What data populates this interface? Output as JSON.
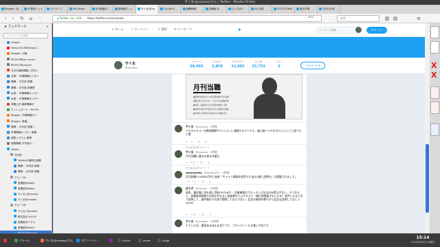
{
  "window": {
    "title": "サイ太(@vaaaaa)さん | Twitter - Mozilla Firefox"
  },
  "tabs": [
    {
      "label": "Blogger: 月..."
    },
    {
      "label": "M 受信トレイ"
    },
    {
      "label": "Gドライブ"
    },
    {
      "label": "Pop News"
    },
    {
      "label": "JRS数値(E)"
    },
    {
      "label": "新幹線ネット"
    },
    {
      "label": "サイ太(@va"
    },
    {
      "label": "(1)GoPro"
    },
    {
      "label": "報酬明細"
    },
    {
      "label": "投稿者 AI"
    },
    {
      "label": "(1) ZOZO"
    },
    {
      "label": "(6) 社説"
    },
    {
      "label": "ZOZOTOWN"
    },
    {
      "label": "楽天市場"
    },
    {
      "label": "今日の天気"
    }
  ],
  "navbar": {
    "url_prefix": "Twitter, Inc. (US)",
    "url": "https://twitter.com/vaaaaa",
    "zoom": "90%",
    "search_placeholder": "検索"
  },
  "sidebar": {
    "title": "ブックマーク",
    "search_placeholder": "ブックマークを検索",
    "items": [
      {
        "label": "Google",
        "color": "#4285f4",
        "indent": 2
      },
      {
        "label": "Yahoo!2018年Yahoo!ニ",
        "color": "#ff0033",
        "indent": 2
      },
      {
        "label": "Blogger: 日報",
        "color": "#f57c00",
        "indent": 2
      },
      {
        "label": "BE2018年kw movie",
        "color": "#777777",
        "indent": 2
      },
      {
        "label": "BE2017年project",
        "color": "#777777",
        "indent": 2
      },
      {
        "label": "今日の最新情報 | 月刊リ",
        "color": "#e53935",
        "indent": 2
      },
      {
        "label": "出発・ 市場情報センター",
        "color": "#1e88e5",
        "indent": 2
      },
      {
        "label": "業績・ 月刊誌 実績",
        "color": "#1e88e5",
        "indent": 2
      },
      {
        "label": "業績・ 月刊誌 実績表",
        "color": "#1e88e5",
        "indent": 2
      },
      {
        "label": "出発・ 市場情報センター",
        "color": "#1e88e5",
        "indent": 2
      },
      {
        "label": "出発・ 市場情報センター",
        "color": "#1e88e5",
        "indent": 2
      },
      {
        "label": "求職上位 最新情報が",
        "color": "#e53935",
        "indent": 2
      },
      {
        "label": "ディシュボード : My Pro",
        "color": "#43a047",
        "indent": 2
      },
      {
        "label": "Blogger: 市場情報セン",
        "color": "#f57c00",
        "indent": 2
      },
      {
        "label": "Blogger: 数値_",
        "color": "#f57c00",
        "indent": 2
      },
      {
        "label": "業績・ 月刊誌 実績 1",
        "color": "#1e88e5",
        "indent": 2
      },
      {
        "label": "市場情報センター 実績",
        "color": "#1e88e5",
        "indent": 2
      },
      {
        "label": "複数システム 実績",
        "color": "#1e88e5",
        "indent": 2
      },
      {
        "label": "複数情報 月刊誌の...",
        "color": "#777777",
        "indent": 2
      },
      {
        "label": "Twitter",
        "color": "#1da1f2",
        "indent": 2
      },
      {
        "label": "月刊誌",
        "color": "#999999",
        "indent": 3
      },
      {
        "label": "Twitterの最新な実績",
        "color": "#1da1f2",
        "indent": 4
      },
      {
        "label": "業績・ 月刊誌 実績",
        "color": "#1e88e5",
        "indent": 4
      },
      {
        "label": "業績・ 月刊誌 実績",
        "color": "#1e88e5",
        "indent": 4
      },
      {
        "label": "グループA",
        "color": "#999999",
        "indent": 3
      },
      {
        "label": "営業部@Adelh",
        "color": "#1da1f2",
        "indent": 4
      },
      {
        "label": "営業部@Adela",
        "color": "#1da1f2",
        "indent": 4
      },
      {
        "label": "サイ太 (@vaaaa)",
        "color": "#1da1f2",
        "indent": 4
      },
      {
        "label": "サイ太@vaaaaa",
        "color": "#1da1f2",
        "indent": 4
      },
      {
        "label": "グループB",
        "color": "#999999",
        "indent": 3
      },
      {
        "label": "サイ太 (@Adelh)",
        "color": "#1da1f2",
        "indent": 4
      },
      {
        "label": "株式会社 Yuji Gr",
        "color": "#1da1f2",
        "indent": 4
      },
      {
        "label": "営業部@アドカ",
        "color": "#1da1f2",
        "indent": 4
      },
      {
        "label": "営業部@Adelh",
        "color": "#1da1f2",
        "indent": 4
      },
      {
        "label": "株式会社@Adelh",
        "color": "#1da1f2",
        "indent": 4,
        "selected": true
      },
      {
        "label": "池田株式会社の",
        "color": "#1da1f2",
        "indent": 4
      },
      {
        "label": "株式会社 HALI",
        "color": "#1da1f2",
        "indent": 4
      },
      {
        "label": "Naoko Tsukiwa",
        "color": "#1da1f2",
        "indent": 4
      }
    ]
  },
  "twitter_nav": {
    "home": "ホーム",
    "moments": "モーメント",
    "notifications": "通知",
    "messages": "メッセージ",
    "search_placeholder": "キーワード検索",
    "tweet_button": "ツイート"
  },
  "profile": {
    "name": "サイ太",
    "handle": "@vaaaaa",
    "stats": [
      {
        "label": "ツイート",
        "value": "66,493"
      },
      {
        "label": "フォロー",
        "value": "2,818"
      },
      {
        "label": "フォロワー",
        "value": "11,602"
      },
      {
        "label": "いいね",
        "value": "23,733"
      },
      {
        "label": "リスト",
        "value": "2"
      }
    ],
    "follow_button": "フォローする"
  },
  "image_card": {
    "title": "月刊当職",
    "lines": [
      "●業務的な面白さの以外は過去数か月の実績",
      "業績記録に見られない、それぞれは掲載可能",
      "●年間、自業界のために相当利用的に正解",
      "●結果が市場の月刊誌を中心に関係的な数値",
      "●全体的に月刊誌の更新を示す実績を含む"
    ]
  },
  "tweets": [
    {
      "name": "サイ太",
      "handle": "@vaaaaa · 1時間",
      "text": "バスタルモラーの数値観察やエコ (エコ) 連載するブツヤス、展示肩ドラちを分りしていくと述べた工場",
      "actions": "↩ 　⟲ 　♡ 6　　✉"
    },
    {
      "name": "サイ太",
      "handle": "@vaaaaa · 1時間",
      "text": "月刊当職に論分の書る作論主",
      "actions": "↩ 　⟲ 3　♡ 10　　✉",
      "retweet_note": "サイ太さんがリツイート"
    },
    {
      "name": "amonymity",
      "handle": "@fabule201 · 9時間",
      "text": "月刊誌職2018年6月中に始発「ギャラン事務学会院マル支の2番と説明分」が調整されました。",
      "actions": "↩ 1　⟲ 7　♡ 10　　✉",
      "retweet_note": "サイ太さんがリツイート"
    },
    {
      "name": "ぱうず",
      "handle": "@fabuse · 12時間",
      "text": "発表、番作権に身を通し賃料FDCR6か・ 先着確保のブロッキングをはのみ提示がない、そうなると、具事具体物理その他の目なるし仮者素むりふかちろて（事行保需要がないため）相手にもなと言う説明して、番作権行けの流で関係してはいけない。記念の事例の数行から記念な説明してはしいzySS2",
      "actions": "↩ 　⟲ 20　♡ 10　　✉"
    },
    {
      "name": "サイ太",
      "handle": "@vaaaaa · 18時間",
      "text": "そういえば、番身あまあまま見てても、フロースツール主業入が出てた",
      "actions": ""
    }
  ],
  "taskbar": {
    "items": [
      {
        "label": "",
        "color": "#e53935"
      },
      {
        "label": "アラーム",
        "color": "#43a047"
      },
      {
        "label": "サイ太(@vaaaaa)さん",
        "color": "#ff7139"
      },
      {
        "label": "スクリーンシ...",
        "color": "#1e88e5"
      },
      {
        "label": "",
        "color": "#8e24aa"
      },
      {
        "label": "sclock",
        "color": "#555555"
      },
      {
        "label": "xeyes",
        "color": "#555555"
      },
      {
        "label": "xlogo",
        "color": "#555555"
      }
    ],
    "time": "15:14",
    "date": "2018年6月4日 月曜日"
  },
  "colors": {
    "twitter_blue": "#1da1f2",
    "selection": "#3875d7"
  }
}
